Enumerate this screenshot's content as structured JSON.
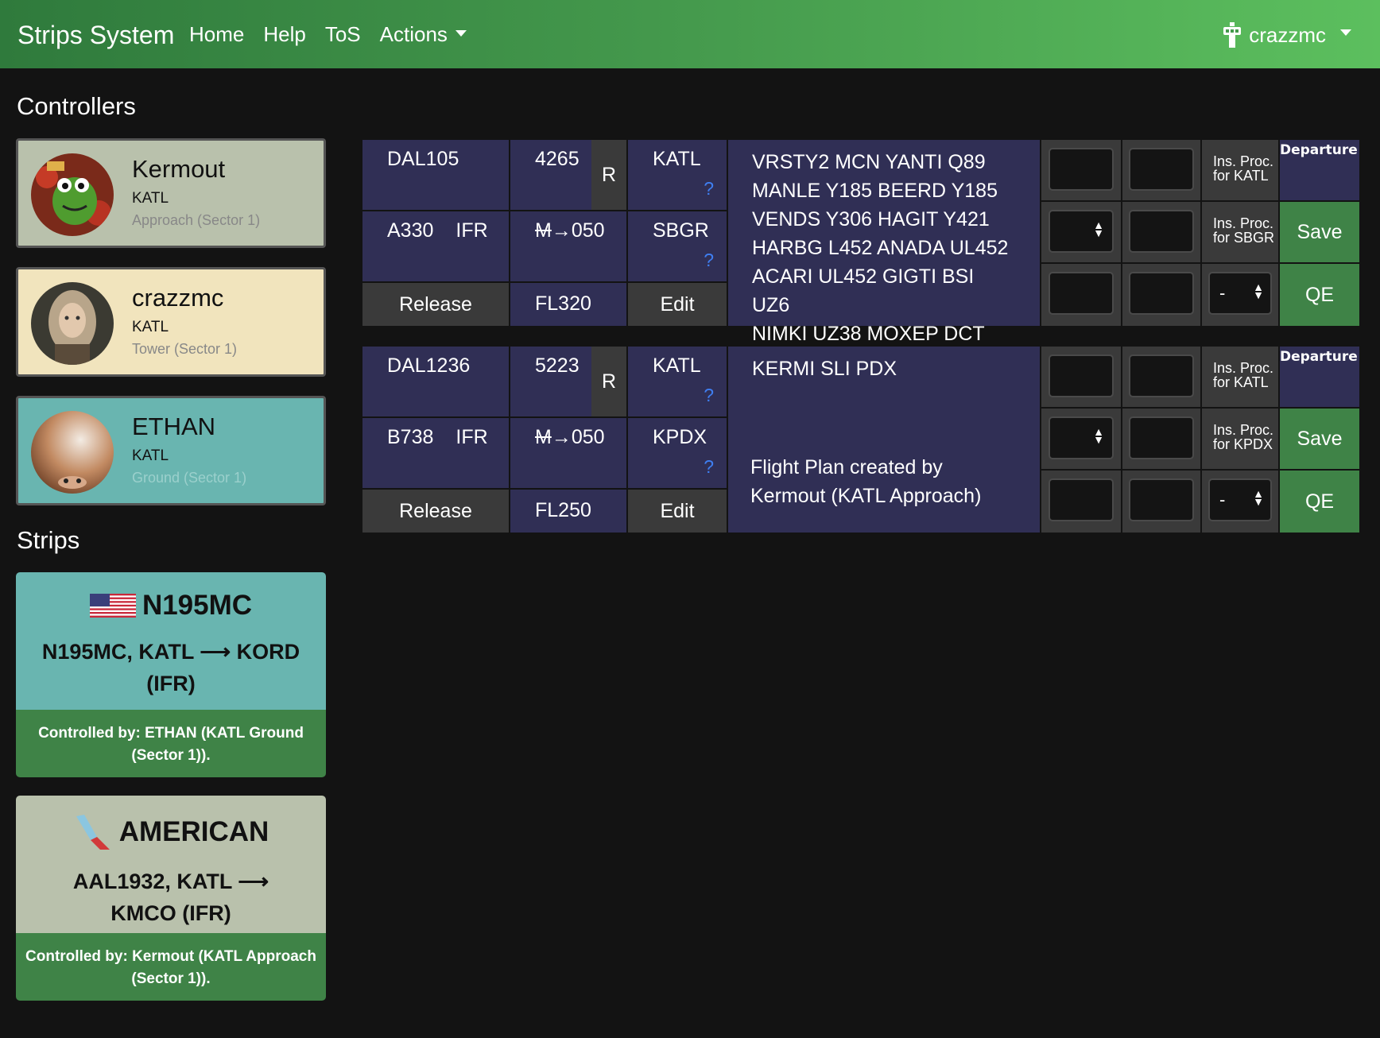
{
  "navbar": {
    "brand": "Strips System",
    "links": [
      "Home",
      "Help",
      "ToS",
      "Actions"
    ],
    "user": "crazzmc"
  },
  "sections": {
    "controllers": "Controllers",
    "strips": "Strips"
  },
  "controllers": [
    {
      "name": "Kermout",
      "airport": "KATL",
      "position": "Approach (Sector 1)",
      "bg": "#b9c1ac"
    },
    {
      "name": "crazzmc",
      "airport": "KATL",
      "position": "Tower (Sector 1)",
      "bg": "#f1e4bd"
    },
    {
      "name": "ETHAN",
      "airport": "KATL",
      "position": "Ground (Sector 1)",
      "bg": "#69b5b0"
    }
  ],
  "strip_cards": [
    {
      "title": "N195MC",
      "route": "N195MC, KATL ⟶ KORD (IFR)",
      "controlled_by": "Controlled by: ETHAN (KATL Ground (Sector 1)).",
      "bg": "#69b5b0"
    },
    {
      "title": "AMERICAN",
      "route": "AAL1932, KATL ⟶ KMCO (IFR)",
      "controlled_by": "Controlled by: Kermout (KATL Approach (Sector 1)).",
      "bg": "#b9c1ac"
    }
  ],
  "flight_strips": [
    {
      "callsign": "DAL105",
      "squawk": "4265",
      "rules_flag": "R",
      "departure": "KATL",
      "aircraft": "A330",
      "flight_rules": "IFR",
      "alt_from": "M",
      "alt_to": "→050",
      "arrival": "SBGR",
      "release_label": "Release",
      "cruise": "FL320",
      "edit_label": "Edit",
      "route_lines": [
        "VRSTY2 MCN YANTI Q89",
        "MANLE Y185 BEERD Y185",
        "VENDS Y306 HAGIT Y421",
        "HARBG L452 ANADA UL452",
        "ACARI UL452 GIGTI BSI UZ6",
        "NIMKI UZ38 MOXEP DCT"
      ],
      "remarks": "",
      "ins_proc_1": "Ins. Proc. for KATL",
      "ins_proc_2": "Ins. Proc. for SBGR",
      "strip_type": "Departure",
      "save_label": "Save",
      "select_value": "-",
      "qe_label": "QE",
      "q_mark": "?"
    },
    {
      "callsign": "DAL1236",
      "squawk": "5223",
      "rules_flag": "R",
      "departure": "KATL",
      "aircraft": "B738",
      "flight_rules": "IFR",
      "alt_from": "M",
      "alt_to": "→050",
      "arrival": "KPDX",
      "release_label": "Release",
      "cruise": "FL250",
      "edit_label": "Edit",
      "route_lines": [
        "KERMI SLI PDX"
      ],
      "remarks": "Flight Plan created by Kermout (KATL Approach)",
      "ins_proc_1": "Ins. Proc. for KATL",
      "ins_proc_2": "Ins. Proc. for KPDX",
      "strip_type": "Departure",
      "save_label": "Save",
      "select_value": "-",
      "qe_label": "QE",
      "q_mark": "?"
    }
  ]
}
